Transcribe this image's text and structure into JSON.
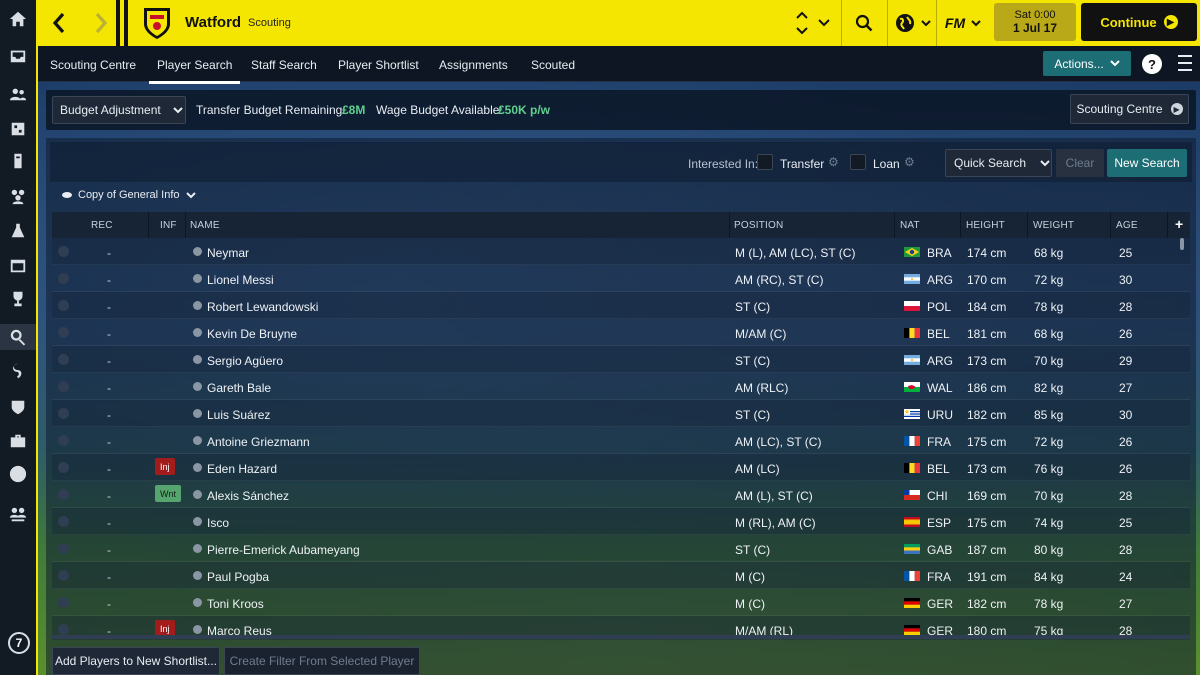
{
  "topbar": {
    "club_name": "Watford",
    "section": "Scouting",
    "date_day": "Sat 0:00",
    "date": "1 Jul 17",
    "continue_label": "Continue",
    "manager_logo": "FM"
  },
  "tabs": [
    "Scouting Centre",
    "Player Search",
    "Staff Search",
    "Player Shortlist",
    "Assignments",
    "Scouted"
  ],
  "active_tab": "Player Search",
  "actions_label": "Actions...",
  "budget": {
    "adjust_label": "Budget Adjustment",
    "transfer_label": "Transfer Budget Remaining:",
    "transfer_value": "£8M",
    "wage_label": "Wage Budget Available:",
    "wage_value": "£50K p/w",
    "scouting_centre_label": "Scouting Centre"
  },
  "filters": {
    "interested_label": "Interested In:",
    "transfer_label": "Transfer",
    "loan_label": "Loan",
    "quick_search_label": "Quick Search",
    "clear_label": "Clear",
    "new_search_label": "New Search",
    "view_label": "Copy of General Info"
  },
  "columns": [
    "REC",
    "INF",
    "NAME",
    "POSITION",
    "NAT",
    "HEIGHT",
    "WEIGHT",
    "AGE"
  ],
  "players": [
    {
      "rec": "-",
      "inf": "",
      "name": "Neymar",
      "position": "M (L), AM (LC), ST (C)",
      "nat": "BRA",
      "height": "174 cm",
      "weight": "68 kg",
      "age": "25"
    },
    {
      "rec": "-",
      "inf": "",
      "name": "Lionel Messi",
      "position": "AM (RC), ST (C)",
      "nat": "ARG",
      "height": "170 cm",
      "weight": "72 kg",
      "age": "30"
    },
    {
      "rec": "-",
      "inf": "",
      "name": "Robert Lewandowski",
      "position": "ST (C)",
      "nat": "POL",
      "height": "184 cm",
      "weight": "78 kg",
      "age": "28"
    },
    {
      "rec": "-",
      "inf": "",
      "name": "Kevin De Bruyne",
      "position": "M/AM (C)",
      "nat": "BEL",
      "height": "181 cm",
      "weight": "68 kg",
      "age": "26"
    },
    {
      "rec": "-",
      "inf": "",
      "name": "Sergio Agüero",
      "position": "ST (C)",
      "nat": "ARG",
      "height": "173 cm",
      "weight": "70 kg",
      "age": "29"
    },
    {
      "rec": "-",
      "inf": "",
      "name": "Gareth Bale",
      "position": "AM (RLC)",
      "nat": "WAL",
      "height": "186 cm",
      "weight": "82 kg",
      "age": "27"
    },
    {
      "rec": "-",
      "inf": "",
      "name": "Luis Suárez",
      "position": "ST (C)",
      "nat": "URU",
      "height": "182 cm",
      "weight": "85 kg",
      "age": "30"
    },
    {
      "rec": "-",
      "inf": "",
      "name": "Antoine Griezmann",
      "position": "AM (LC), ST (C)",
      "nat": "FRA",
      "height": "175 cm",
      "weight": "72 kg",
      "age": "26"
    },
    {
      "rec": "-",
      "inf": "Inj",
      "name": "Eden Hazard",
      "position": "AM (LC)",
      "nat": "BEL",
      "height": "173 cm",
      "weight": "76 kg",
      "age": "26"
    },
    {
      "rec": "-",
      "inf": "Wnt",
      "name": "Alexis Sánchez",
      "position": "AM (L), ST (C)",
      "nat": "CHI",
      "height": "169 cm",
      "weight": "70 kg",
      "age": "28"
    },
    {
      "rec": "-",
      "inf": "",
      "name": "Isco",
      "position": "M (RL), AM (C)",
      "nat": "ESP",
      "height": "175 cm",
      "weight": "74 kg",
      "age": "25"
    },
    {
      "rec": "-",
      "inf": "",
      "name": "Pierre-Emerick Aubameyang",
      "position": "ST (C)",
      "nat": "GAB",
      "height": "187 cm",
      "weight": "80 kg",
      "age": "28"
    },
    {
      "rec": "-",
      "inf": "",
      "name": "Paul Pogba",
      "position": "M (C)",
      "nat": "FRA",
      "height": "191 cm",
      "weight": "84 kg",
      "age": "24"
    },
    {
      "rec": "-",
      "inf": "",
      "name": "Toni Kroos",
      "position": "M (C)",
      "nat": "GER",
      "height": "182 cm",
      "weight": "78 kg",
      "age": "27"
    },
    {
      "rec": "-",
      "inf": "Inj",
      "name": "Marco Reus",
      "position": "M/AM (RL)",
      "nat": "GER",
      "height": "180 cm",
      "weight": "75 kg",
      "age": "28"
    }
  ],
  "bottom": {
    "add_players_label": "Add Players to New Shortlist...",
    "create_filter_label": "Create Filter From Selected Player"
  },
  "rail_badge": "7",
  "colors": {
    "brand_yellow": "#f4e600",
    "accent_teal": "#1c6e74",
    "money_green": "#5fd08e",
    "injury_red": "#a21c1c",
    "wanted_green": "#57a56e"
  }
}
